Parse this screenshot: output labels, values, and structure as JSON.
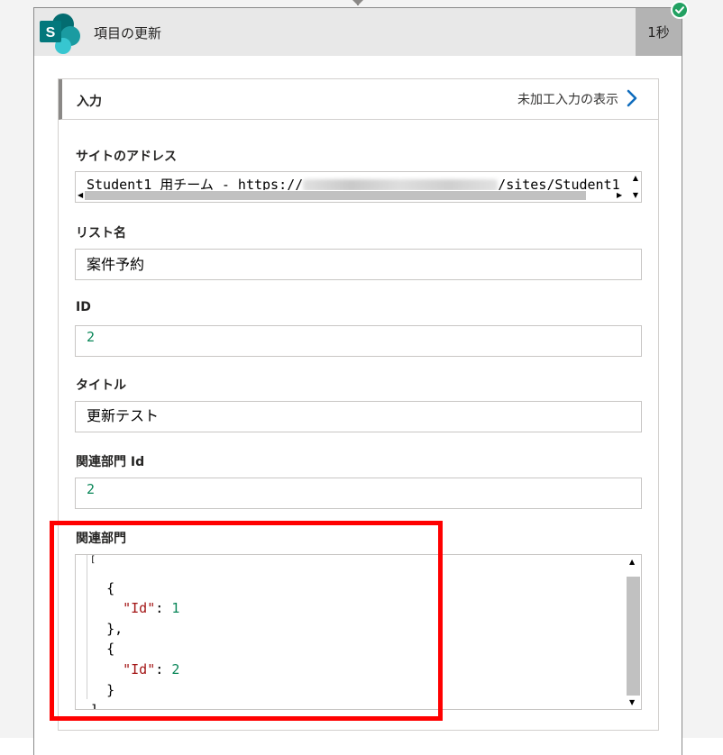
{
  "header": {
    "title": "項目の更新",
    "duration": "1秒",
    "logo_letter": "S",
    "status": "success"
  },
  "inputs_panel": {
    "label": "入力",
    "raw_inputs_link": "未加工入力の表示"
  },
  "fields": {
    "site_address": {
      "label": "サイトのアドレス",
      "value_prefix": "Student1 用チーム - https://",
      "value_suffix": "/sites/Student1"
    },
    "list_name": {
      "label": "リスト名",
      "value": "案件予約"
    },
    "id": {
      "label": "ID",
      "value": "2"
    },
    "title": {
      "label": "タイトル",
      "value": "更新テスト"
    },
    "related_dept_id": {
      "label": "関連部門 Id",
      "value": "2"
    },
    "related_dept": {
      "label": "関連部門",
      "json_open": "[",
      "items": [
        {
          "brace_open": "{",
          "key": "\"Id\"",
          "value": "1",
          "brace_close": "},"
        },
        {
          "brace_open": "{",
          "key": "\"Id\"",
          "value": "2",
          "brace_close": "}"
        }
      ],
      "json_close": "]"
    }
  },
  "colors": {
    "success": "#22a162",
    "highlight": "#ff0000",
    "sharepoint_teal": "#038387"
  }
}
